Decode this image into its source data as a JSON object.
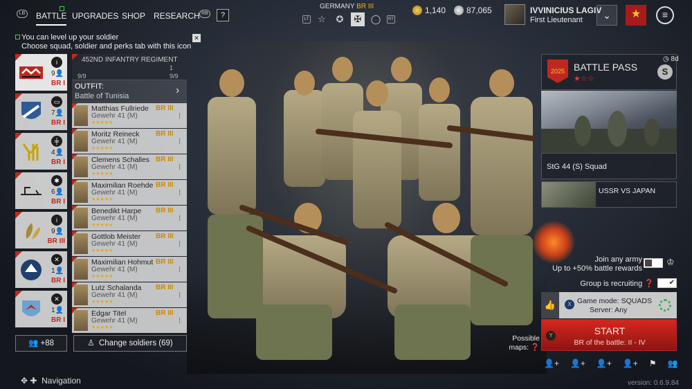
{
  "topbar": {
    "lb": "LB",
    "rb": "RB",
    "tabs": [
      "BATTLE",
      "UPGRADES",
      "SHOP",
      "RESEARCH"
    ],
    "help": "?",
    "nation": "GERMANY",
    "nation_br": "BR III",
    "mode_lt": "LT",
    "mode_rt": "RT",
    "gold": "1,140",
    "silver": "87,065",
    "player_name": "IVVINICIUS LAGIV",
    "player_rank": "First Lieutenant"
  },
  "notice": {
    "line1": "You can level up your soldier",
    "line2": "Choose squad, soldier and perks tab with this icon",
    "close": "✕"
  },
  "squads": [
    {
      "count": "9",
      "br": "BR I",
      "type_icon": "info-icon"
    },
    {
      "count": "7",
      "br": "BR I",
      "type_icon": "tank-icon"
    },
    {
      "count": "4",
      "br": "BR I",
      "type_icon": "mg-icon"
    },
    {
      "count": "6",
      "br": "BR I",
      "type_icon": "grenade-icon"
    },
    {
      "count": "9",
      "br": "BR III",
      "type_icon": "info-icon"
    },
    {
      "count": "1",
      "br": "BR I",
      "type_icon": "tools-icon"
    },
    {
      "count": "1",
      "br": "BR I",
      "type_icon": "tools-icon"
    }
  ],
  "regiment": {
    "name": "452ND INFANTRY REGIMENT",
    "count_left": "9/9",
    "count_right": "9/9",
    "count_top": "1",
    "outfit_label": "OUTFIT:",
    "outfit_value": "Battle of Tunisia"
  },
  "soldiers": [
    {
      "name": "Matthias Fullriede",
      "br": "BR III",
      "weapon": "Gewehr 41 (M)",
      "stars": "★★★★★"
    },
    {
      "name": "Moritz Reineck",
      "br": "BR III",
      "weapon": "Gewehr 41 (M)",
      "stars": "★★★★★"
    },
    {
      "name": "Clemens Schalles",
      "br": "BR III",
      "weapon": "Gewehr 41 (M)",
      "stars": "★★★★★"
    },
    {
      "name": "Maximilian Roehde",
      "br": "BR III",
      "weapon": "Gewehr 41 (M)",
      "stars": "★★★★★"
    },
    {
      "name": "Benedikt Harpe",
      "br": "BR III",
      "weapon": "Gewehr 41 (M)",
      "stars": "★★★★★"
    },
    {
      "name": "Gottlob Meister",
      "br": "BR III",
      "weapon": "Gewehr 41 (M)",
      "stars": "★★★★★"
    },
    {
      "name": "Maximilian Hohmut",
      "br": "BR III",
      "weapon": "Gewehr 41 (M)",
      "stars": "★★★★★"
    },
    {
      "name": "Lutz Schalanda",
      "br": "BR III",
      "weapon": "Gewehr 41 (M)",
      "stars": "★★★★★"
    },
    {
      "name": "Edgar Titel",
      "br": "BR III",
      "weapon": "Gewehr 41 (M)",
      "stars": "★★★★★"
    }
  ],
  "bottom": {
    "recruit_label": "+88",
    "change_label": "Change soldiers (69)",
    "nav_label": "Navigation"
  },
  "battle_pass": {
    "title": "BATTLE PASS",
    "stars": "★☆☆",
    "timer": "8d",
    "season_badge": "S",
    "featured_caption": "StG 44 (S) Squad",
    "event_caption": "USSR VS JAPAN"
  },
  "matchmaking": {
    "join_line1": "Join any army",
    "join_line2": "Up to +50% battle rewards",
    "group_label": "Group is recruiting",
    "game_mode": "Game mode: SQUADS",
    "server": "Server: Any",
    "start": "START",
    "battle_br": "BR of the battle: II - IV",
    "maps_line1": "Possible",
    "maps_line2": "maps:"
  },
  "version": "version: 0.6.9.84",
  "colors": {
    "accent_red": "#c0281f",
    "br_gold": "#e8a512"
  }
}
